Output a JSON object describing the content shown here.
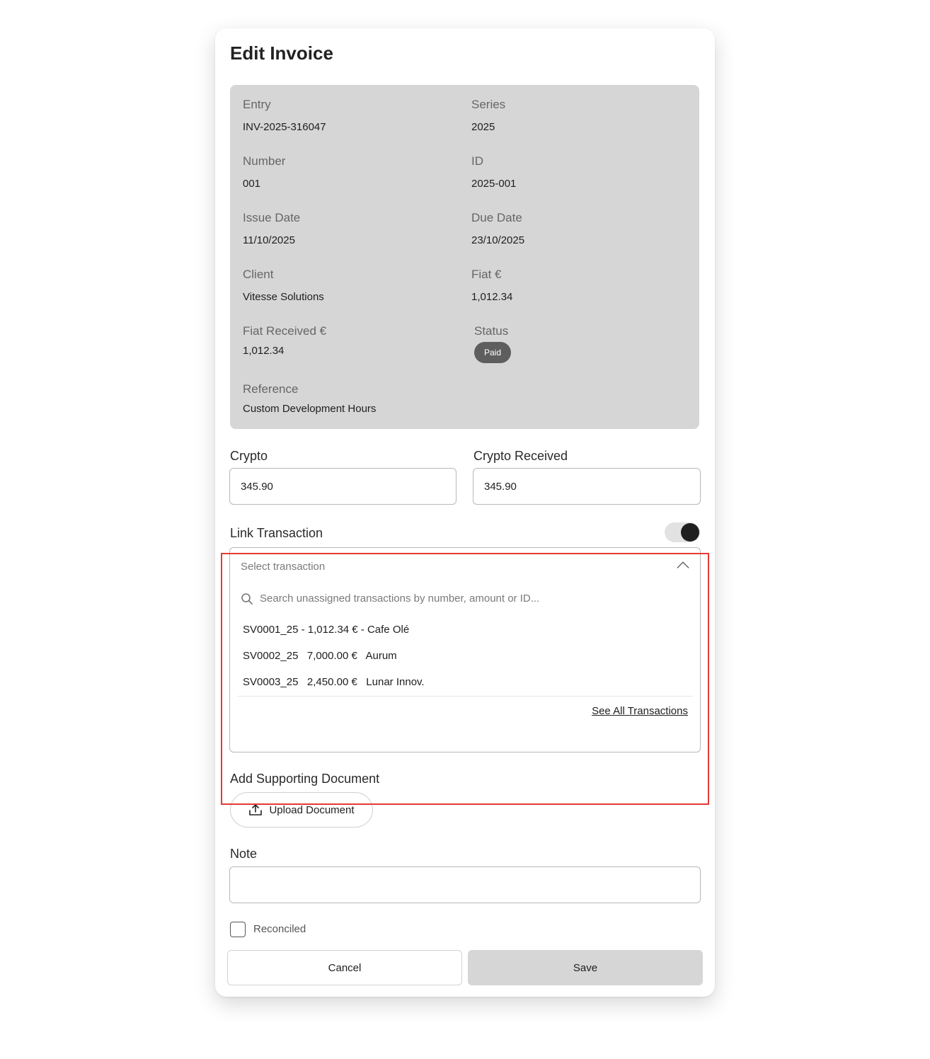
{
  "modal": {
    "title": "Edit Invoice"
  },
  "info": {
    "entry": {
      "label": "Entry",
      "value": "INV-2025-316047"
    },
    "series": {
      "label": "Series",
      "value": "2025"
    },
    "number": {
      "label": "Number",
      "value": "001"
    },
    "id": {
      "label": "ID",
      "value": "2025-001"
    },
    "issue_date": {
      "label": "Issue Date",
      "value": "11/10/2025"
    },
    "due_date": {
      "label": "Due Date",
      "value": "23/10/2025"
    },
    "client": {
      "label": "Client",
      "value": "Vitesse Solutions"
    },
    "fiat": {
      "label": "Fiat €",
      "value": "1,012.34"
    },
    "fiat_received": {
      "label": "Fiat Received €",
      "value": "1,012.34"
    },
    "status": {
      "label": "Status",
      "value": "Paid",
      "badge_color": "#5e5e5e"
    },
    "reference": {
      "label": "Reference",
      "value": "Custom Development Hours"
    }
  },
  "crypto": {
    "label": "Crypto",
    "value": "345.90"
  },
  "crypto_received": {
    "label": "Crypto Received",
    "value": "345.90"
  },
  "link_transaction": {
    "label": "Link Transaction",
    "enabled": true
  },
  "transaction_dropdown": {
    "placeholder": "Select transaction",
    "search_placeholder": "Search unassigned transactions by number, amount or ID...",
    "items": [
      {
        "text": "SV0001_25 - 1,012.34 € - Cafe Olé"
      },
      {
        "text": "SV0002_25   7,000.00 €   Aurum"
      },
      {
        "text": "SV0003_25   2,450.00 €   Lunar Innov."
      }
    ],
    "see_all": "See All Transactions"
  },
  "supporting_document": {
    "label": "Add Supporting Document",
    "upload_label": "Upload Document"
  },
  "note": {
    "label": "Note",
    "value": ""
  },
  "reconciled": {
    "label": "Reconciled",
    "checked": false
  },
  "actions": {
    "cancel": "Cancel",
    "save": "Save"
  },
  "highlight_color": "#e53935"
}
